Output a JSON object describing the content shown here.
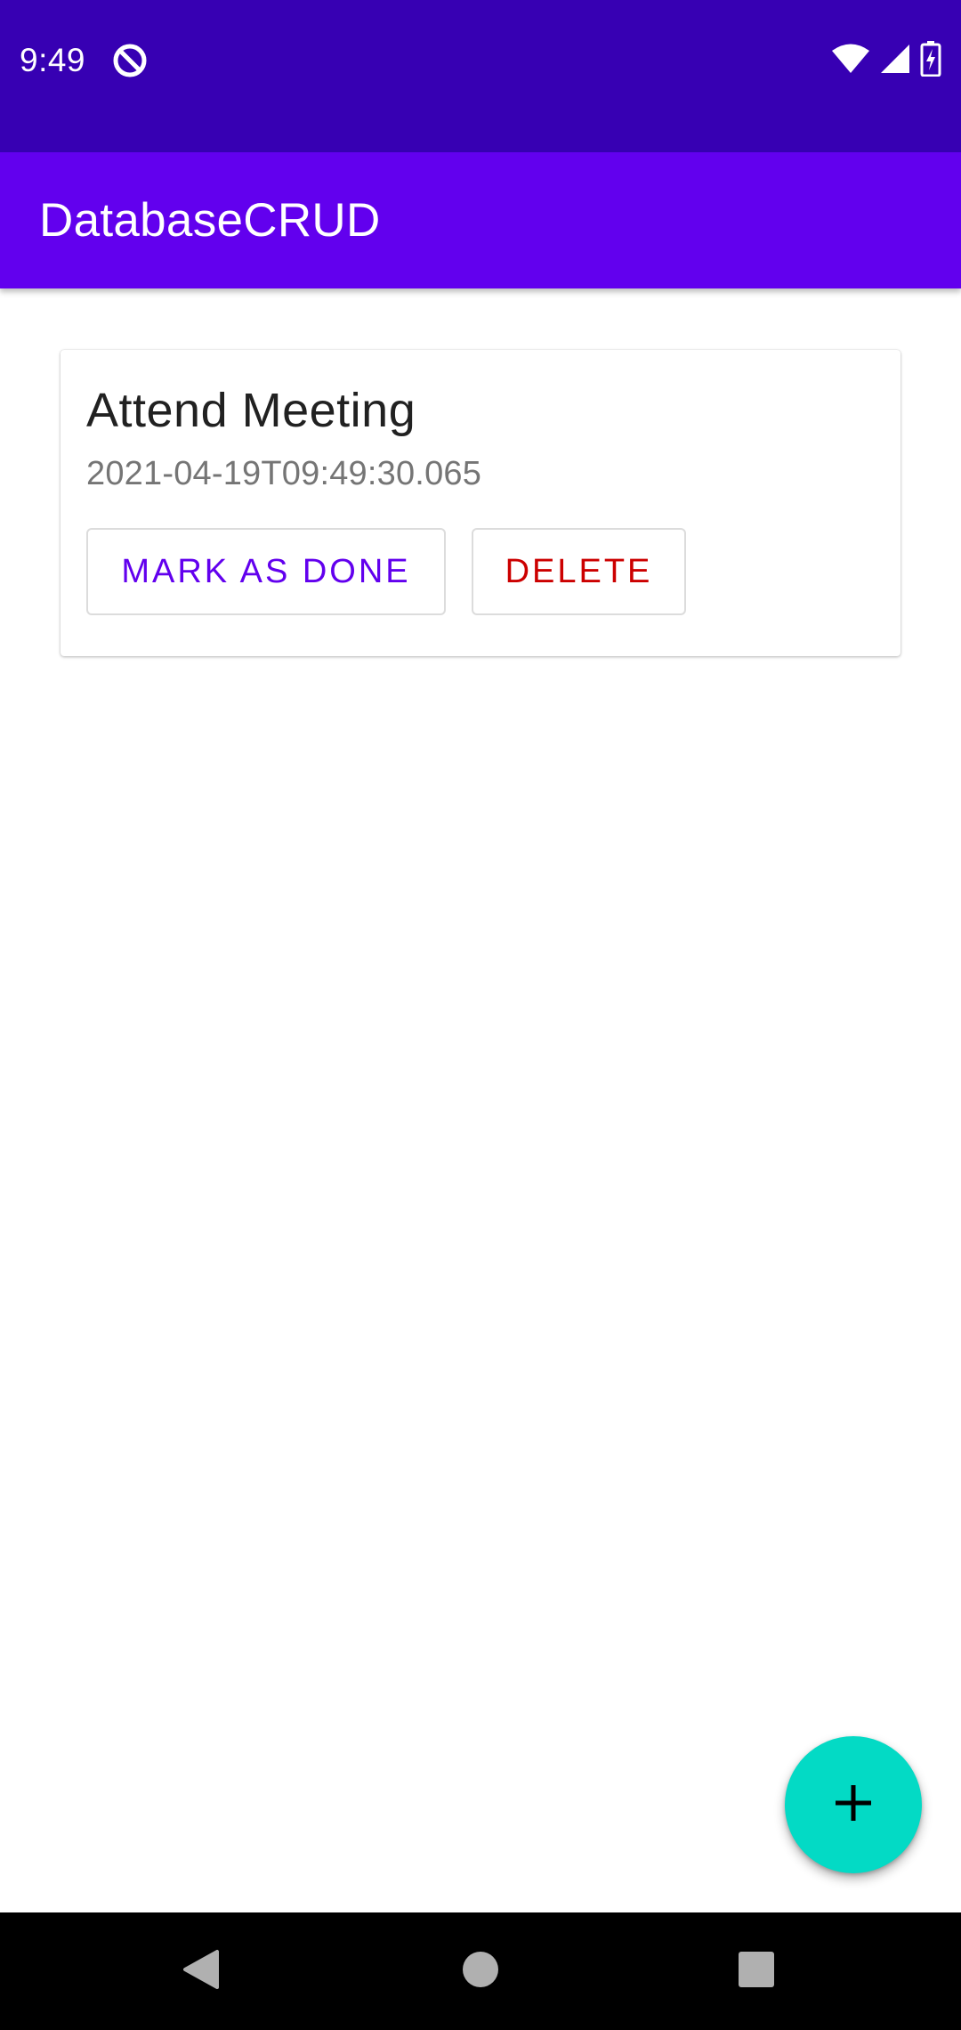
{
  "status_bar": {
    "time": "9:49",
    "icons": [
      "do-not-disturb-icon",
      "wifi-icon",
      "cell-signal-icon",
      "battery-charging-icon"
    ]
  },
  "app_bar": {
    "title": "DatabaseCRUD"
  },
  "tasks": [
    {
      "title": "Attend Meeting",
      "timestamp": "2021-04-19T09:49:30.065",
      "mark_done_label": "MARK AS DONE",
      "delete_label": "DELETE"
    }
  ],
  "fab": {
    "icon": "plus-icon"
  },
  "nav_bar": {
    "buttons": [
      "back-icon",
      "home-icon",
      "recents-icon"
    ]
  },
  "colors": {
    "status_bar": "#3700b3",
    "app_bar": "#6200ee",
    "primary": "#6200ee",
    "delete": "#cc0000",
    "fab": "#03dac5"
  }
}
